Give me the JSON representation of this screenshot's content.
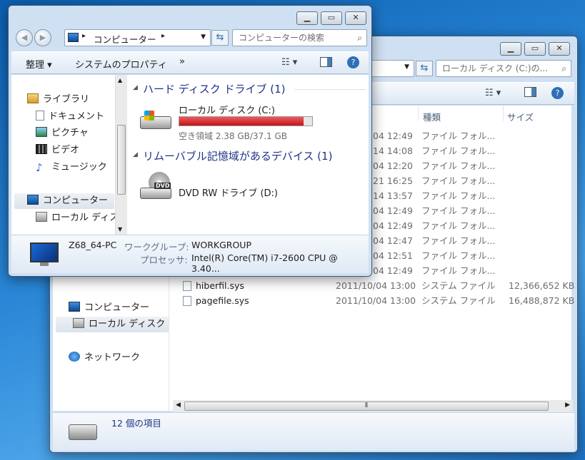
{
  "back_window": {
    "address": "ローカル ディスク (C:)の...",
    "columns": {
      "type": "種類",
      "size": "サイズ"
    },
    "rows": [
      {
        "date": "04 12:49",
        "type": "ファイル フォル...",
        "size": ""
      },
      {
        "date": "14 14:08",
        "type": "ファイル フォル...",
        "size": ""
      },
      {
        "date": "04 12:20",
        "type": "ファイル フォル...",
        "size": ""
      },
      {
        "date": "21 16:25",
        "type": "ファイル フォル...",
        "size": ""
      },
      {
        "date": "14 13:57",
        "type": "ファイル フォル...",
        "size": ""
      },
      {
        "date": "04 12:49",
        "type": "ファイル フォル...",
        "size": ""
      },
      {
        "date": "04 12:49",
        "type": "ファイル フォル...",
        "size": ""
      },
      {
        "date": "04 12:47",
        "type": "ファイル フォル...",
        "size": ""
      },
      {
        "date": "04 12:51",
        "type": "ファイル フォル...",
        "size": ""
      },
      {
        "date": "04 12:49",
        "type": "ファイル フォル...",
        "size": ""
      }
    ],
    "files": [
      {
        "name": "hiberfil.sys",
        "date": "2011/10/04 13:00",
        "type": "システム ファイル",
        "size": "12,366,652 KB"
      },
      {
        "name": "pagefile.sys",
        "date": "2011/10/04 13:00",
        "type": "システム ファイル",
        "size": "16,488,872 KB"
      }
    ],
    "nav": {
      "computer": "コンピューター",
      "local_disk": "ローカル ディスク (",
      "network": "ネットワーク"
    },
    "status": "12 個の項目"
  },
  "front_window": {
    "breadcrumb": "コンピューター",
    "search_placeholder": "コンピューターの検索",
    "toolbar": {
      "organize": "整理",
      "system_properties": "システムのプロパティ",
      "more": "»"
    },
    "nav": {
      "libraries": "ライブラリ",
      "documents": "ドキュメント",
      "pictures": "ピクチャ",
      "videos": "ビデオ",
      "music": "ミュージック",
      "computer": "コンピューター",
      "local_disk": "ローカル ディス"
    },
    "group_hdd": "ハード ディスク ドライブ (1)",
    "drive_c": {
      "name": "ローカル ディスク (C:)",
      "free": "空き領域 2.38 GB/37.1 GB",
      "used_fraction": 0.936
    },
    "group_removable": "リムーバブル記憶域があるデバイス (1)",
    "drive_d": {
      "name": "DVD RW ドライブ (D:)",
      "badge": "DVD"
    },
    "details": {
      "pc_name": "Z68_64-PC",
      "workgroup_label": "ワークグループ:",
      "workgroup": "WORKGROUP",
      "processor_label": "プロセッサ:",
      "processor": "Intel(R) Core(TM) i7-2600 CPU @ 3.40..."
    }
  },
  "colors": {
    "accent": "#1e3287",
    "bar_fill": "#cc1f2a",
    "link": "#1e3287"
  }
}
